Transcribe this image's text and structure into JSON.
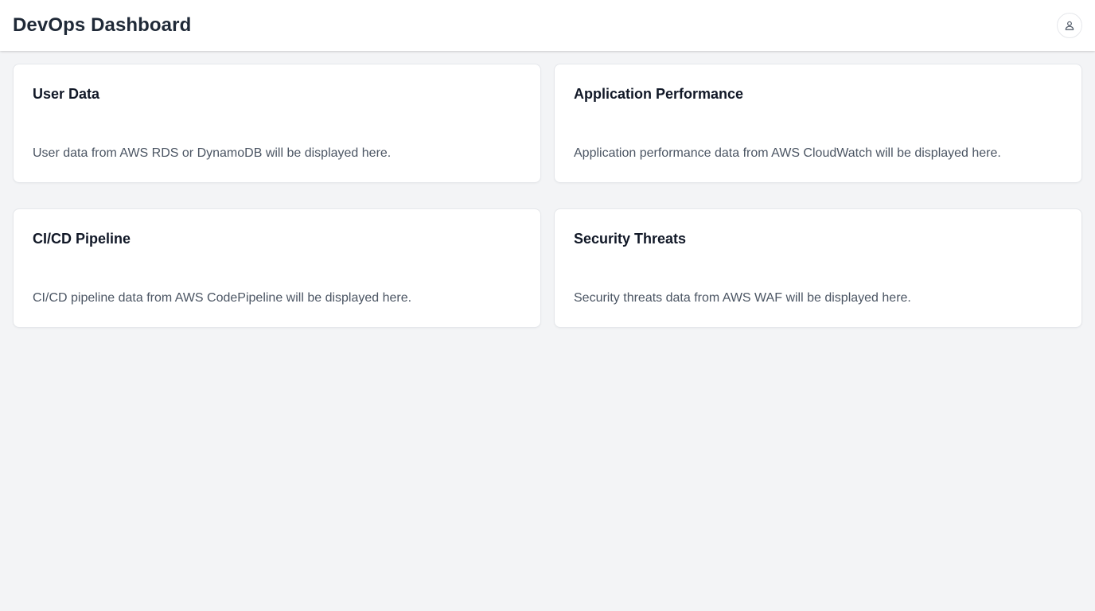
{
  "header": {
    "title": "DevOps Dashboard",
    "user_icon": "user-icon"
  },
  "cards": [
    {
      "title": "User Data",
      "description": "User data from AWS RDS or DynamoDB will be displayed here."
    },
    {
      "title": "Application Performance",
      "description": "Application performance data from AWS CloudWatch will be displayed here."
    },
    {
      "title": "CI/CD Pipeline",
      "description": "CI/CD pipeline data from AWS CodePipeline will be displayed here."
    },
    {
      "title": "Security Threats",
      "description": "Security threats data from AWS WAF will be displayed here."
    }
  ],
  "colors": {
    "background": "#f3f4f6",
    "card": "#ffffff",
    "title_text": "#111827",
    "body_text": "#4b5563"
  }
}
